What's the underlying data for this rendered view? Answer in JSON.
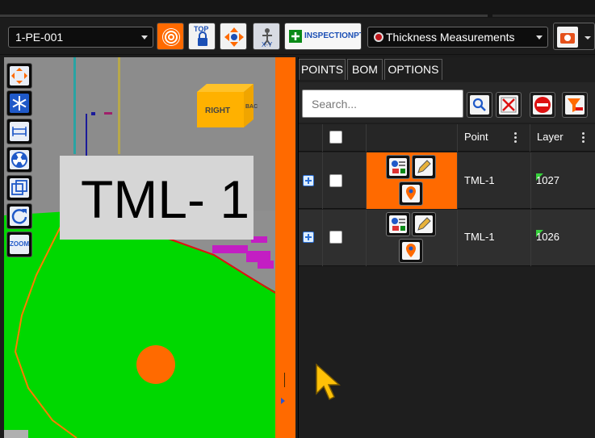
{
  "toolbar": {
    "asset_select": "1-PE-001",
    "top_lock_label": "TOP",
    "xy_label": "X-Y",
    "inspection_point_label": "INSPECTIONPT",
    "measurement_select": "Thickness Measurements"
  },
  "viewport": {
    "label_text": "TML- 1",
    "view_cube": {
      "front": "RIGHT",
      "side": "BAC"
    },
    "zoom_label": "ZOOM"
  },
  "panel": {
    "tabs": [
      {
        "label": "POINTS",
        "active": true
      },
      {
        "label": "BOM",
        "active": false
      },
      {
        "label": "OPTIONS",
        "active": false
      }
    ],
    "search_placeholder": "Search...",
    "columns": {
      "point": "Point",
      "layer": "Layer"
    },
    "rows": [
      {
        "point": "TML-1",
        "layer": "1027",
        "highlighted": true
      },
      {
        "point": "TML-1",
        "layer": "1026",
        "highlighted": false
      }
    ]
  },
  "colors": {
    "accent_orange": "#ff6a00",
    "viewport_green": "#00d800",
    "selection_red": "#e01010",
    "panel_dark": "#1e1e1e",
    "cursor_yellow": "#ffc107"
  }
}
